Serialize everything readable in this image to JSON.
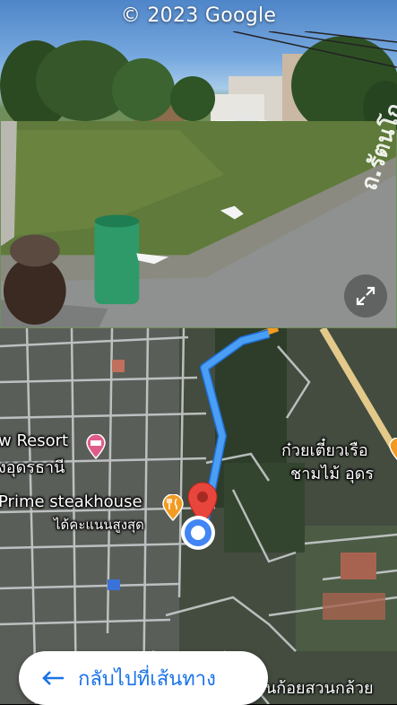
{
  "street_view": {
    "copyright": "© 2023 Google",
    "road_sign": "ถ.รัตนโก"
  },
  "map": {
    "places": {
      "resort_line1": "w Resort",
      "resort_line2": "งอุดรธานี",
      "steakhouse_name": "Prime steakhouse",
      "steakhouse_sub": "ได้คะแนนสูงสุด",
      "noodle_line1": "ก๋วยเตี๋ยวเรือ",
      "noodle_line2": "ชามไม้ อุดร",
      "bottom_road": "นก้อยสวนกล้วย"
    },
    "route_color": "#4a9ff5",
    "pin_color": "#e8453c",
    "location_dot_color": "#4285f4"
  },
  "back_button": {
    "label": "กลับไปที่เส้นทาง"
  }
}
